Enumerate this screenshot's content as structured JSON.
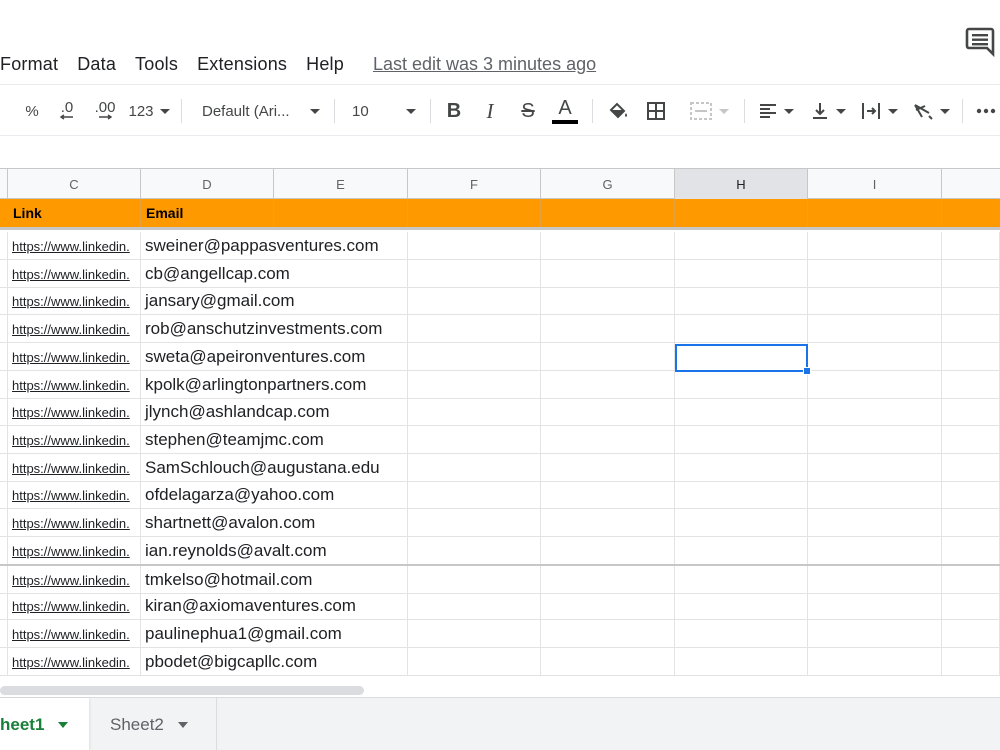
{
  "menu": {
    "items": [
      "Format",
      "Data",
      "Tools",
      "Extensions",
      "Help"
    ],
    "last_edit": "Last edit was 3 minutes ago"
  },
  "toolbar": {
    "percent": "%",
    "decrease_decimal": ".0",
    "increase_decimal": ".00",
    "more_formats": "123",
    "font_family": "Default (Ari...",
    "font_size": "10",
    "bold": "B",
    "italic": "I",
    "strikethrough": "S",
    "text_color": "A",
    "text_color_hex": "#000000"
  },
  "grid": {
    "columns": [
      "C",
      "D",
      "E",
      "F",
      "G",
      "H",
      "I"
    ],
    "selected_column": "H",
    "header_color": "#ff9900",
    "header_row": [
      "Link",
      "Email"
    ],
    "link_text": "https://www.linkedin.",
    "emails": [
      "sweiner@pappasventures.com",
      "cb@angellcap.com",
      "jansary@gmail.com",
      "rob@anschutzinvestments.com",
      "sweta@apeironventures.com",
      "kpolk@arlingtonpartners.com",
      "jlynch@ashlandcap.com",
      "stephen@teamjmc.com",
      "SamSchlouch@augustana.edu",
      "ofdelagarza@yahoo.com",
      "shartnett@avalon.com",
      "ian.reynolds@avalt.com",
      "tmkelso@hotmail.com",
      "kiran@axiomaventures.com",
      "paulinephua1@gmail.com",
      "pbodet@bigcapllc.com"
    ],
    "selection_color": "#1a73e8"
  },
  "sheets": {
    "active": "heet1",
    "others": [
      "Sheet2"
    ],
    "active_color": "#188038"
  },
  "icons": [
    "comment-icon",
    "paint-format-icon",
    "borders-icon",
    "merge-cells-icon",
    "align-left-icon",
    "valign-bottom-icon",
    "text-wrap-icon",
    "text-rotate-icon",
    "more-icon"
  ]
}
